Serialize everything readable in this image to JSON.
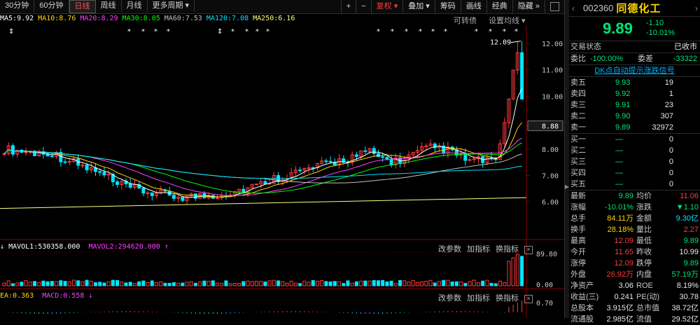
{
  "periods": [
    "30分钟",
    "60分钟",
    "日线",
    "周线",
    "月线",
    "更多周期"
  ],
  "active_period": "日线",
  "toolbar": {
    "plus": "+",
    "minus": "−",
    "fuquan": "复权",
    "diejia": "叠加",
    "chouma": "筹码",
    "huaxian": "画线",
    "jingdian": "经典",
    "yincang": "隐藏"
  },
  "ma": [
    {
      "label": "MA5:9.92",
      "color": "#ffffff"
    },
    {
      "label": "MA10:8.76",
      "color": "#ffd700"
    },
    {
      "label": "MA20:8.29",
      "color": "#ff40ff"
    },
    {
      "label": "MA30:8.05",
      "color": "#00ff00"
    },
    {
      "label": "MA60:7.53",
      "color": "#c0c0c0"
    },
    {
      "label": "MA120:7.08",
      "color": "#00e5ff"
    },
    {
      "label": "MA250:6.16",
      "color": "#ffff80"
    }
  ],
  "chart_links": {
    "kexinbei": "可转债",
    "shezhi": "设置均线"
  },
  "price_axis": [
    "12.00",
    "11.00",
    "10.00",
    "8.88",
    "8.00",
    "7.00",
    "6.00"
  ],
  "high_label": "12.09",
  "current_price_tag": "8.88",
  "vol_header": {
    "mavol1": "MAVOL1:530358.000",
    "mavol2": "MAVOL2:294620.000"
  },
  "vol_axis": [
    "89.80",
    "0.00"
  ],
  "macd_header": {
    "ea": "EA:0.363",
    "macd": "MACD:0.558"
  },
  "macd_axis": "0.70",
  "sub_tools": {
    "gai": "改参数",
    "jia": "加指标",
    "huan": "换指标"
  },
  "stock": {
    "code": "002360",
    "name": "同德化工",
    "price": "9.89",
    "change": "-1.10",
    "pct": "-10.01%"
  },
  "trade_status": {
    "label": "交易状态",
    "value": "已收市"
  },
  "weibi": {
    "label1": "委比",
    "value1": "-100.00%",
    "label2": "委差",
    "value2": "-33322"
  },
  "dk_link": "DK点自动提示涨跌信号",
  "sell": [
    {
      "label": "卖五",
      "price": "9.93",
      "vol": "19"
    },
    {
      "label": "卖四",
      "price": "9.92",
      "vol": "1"
    },
    {
      "label": "卖三",
      "price": "9.91",
      "vol": "23"
    },
    {
      "label": "卖二",
      "price": "9.90",
      "vol": "307"
    },
    {
      "label": "卖一",
      "price": "9.89",
      "vol": "32972"
    }
  ],
  "buy": [
    {
      "label": "买一",
      "price": "—",
      "vol": "0"
    },
    {
      "label": "买二",
      "price": "—",
      "vol": "0"
    },
    {
      "label": "买三",
      "price": "—",
      "vol": "0"
    },
    {
      "label": "买四",
      "price": "—",
      "vol": "0"
    },
    {
      "label": "买五",
      "price": "—",
      "vol": "0"
    }
  ],
  "quotes": [
    {
      "k1": "最新",
      "v1": "9.89",
      "c1": "green",
      "k2": "均价",
      "v2": "11.06",
      "c2": "red"
    },
    {
      "k1": "涨幅",
      "v1": "-10.01%",
      "c1": "green",
      "k2": "涨跌",
      "v2": "▼1.10",
      "c2": "green"
    },
    {
      "k1": "总手",
      "v1": "84.11万",
      "c1": "yellow",
      "k2": "金额",
      "v2": "9.30亿",
      "c2": "cyan"
    },
    {
      "k1": "换手",
      "v1": "28.18%",
      "c1": "yellow",
      "k2": "量比",
      "v2": "2.27",
      "c2": "red"
    },
    {
      "k1": "最高",
      "v1": "12.09",
      "c1": "red",
      "k2": "最低",
      "v2": "9.89",
      "c2": "green"
    },
    {
      "k1": "今开",
      "v1": "11.65",
      "c1": "red",
      "k2": "昨收",
      "v2": "10.99",
      "c2": "white"
    },
    {
      "k1": "涨停",
      "v1": "12.09",
      "c1": "red",
      "k2": "跌停",
      "v2": "9.89",
      "c2": "green"
    },
    {
      "k1": "外盘",
      "v1": "26.92万",
      "c1": "red",
      "k2": "内盘",
      "v2": "57.19万",
      "c2": "green"
    },
    {
      "k1": "净资产",
      "v1": "3.06",
      "c1": "white",
      "k2": "ROE",
      "v2": "8.19%",
      "c2": "white"
    },
    {
      "k1": "收益(三)",
      "v1": "0.241",
      "c1": "white",
      "k2": "PE(动)",
      "v2": "30.78",
      "c2": "white"
    },
    {
      "k1": "总股本",
      "v1": "3.915亿",
      "c1": "white",
      "k2": "总市值",
      "v2": "38.72亿",
      "c2": "white"
    },
    {
      "k1": "流通股",
      "v1": "2.985亿",
      "c1": "white",
      "k2": "流值",
      "v2": "29.52亿",
      "c2": "white"
    }
  ],
  "colors": {
    "up": "#ff3b3b",
    "down": "#00e5ff",
    "bg": "#000000",
    "name": "#ffd700"
  }
}
